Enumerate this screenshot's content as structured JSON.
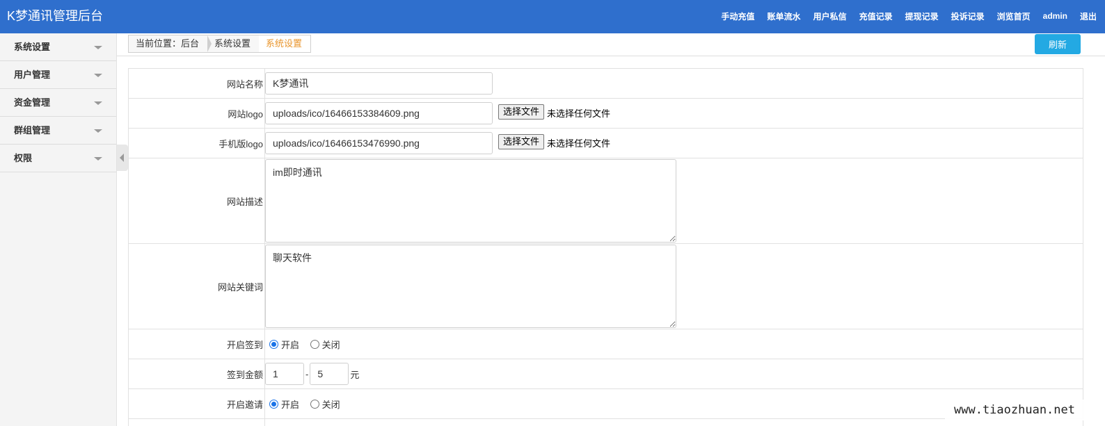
{
  "header": {
    "brand": "K梦通讯管理后台",
    "nav": [
      "手动充值",
      "账单流水",
      "用户私信",
      "充值记录",
      "提现记录",
      "投诉记录",
      "浏览首页",
      "admin",
      "退出"
    ]
  },
  "sidebar": {
    "items": [
      {
        "label": "系统设置"
      },
      {
        "label": "用户管理"
      },
      {
        "label": "资金管理"
      },
      {
        "label": "群组管理"
      },
      {
        "label": "权限"
      }
    ]
  },
  "breadcrumb": [
    "当前位置：后台",
    "系统设置",
    "系统设置"
  ],
  "toolbar": {
    "refresh_label": "刷新"
  },
  "form": {
    "site_name": {
      "label": "网站名称",
      "value": "K梦通讯"
    },
    "site_logo": {
      "label": "网站logo",
      "value": "uploads/ico/16466153384609.png",
      "file_button": "选择文件",
      "file_status": "未选择任何文件"
    },
    "mobile_logo": {
      "label": "手机版logo",
      "value": "uploads/ico/16466153476990.png",
      "file_button": "选择文件",
      "file_status": "未选择任何文件"
    },
    "site_desc": {
      "label": "网站描述",
      "value": "im即时通讯"
    },
    "site_keywords": {
      "label": "网站关键词",
      "value": "聊天软件"
    },
    "checkin": {
      "label": "开启签到",
      "on_label": "开启",
      "off_label": "关闭",
      "selected": "on"
    },
    "checkin_amount": {
      "label": "签到金额",
      "min": "1",
      "separator": "-",
      "max": "5",
      "unit": "元"
    },
    "invite": {
      "label": "开启邀请",
      "on_label": "开启",
      "off_label": "关闭",
      "selected": "on"
    }
  },
  "watermark": "www.tiaozhuan.net"
}
